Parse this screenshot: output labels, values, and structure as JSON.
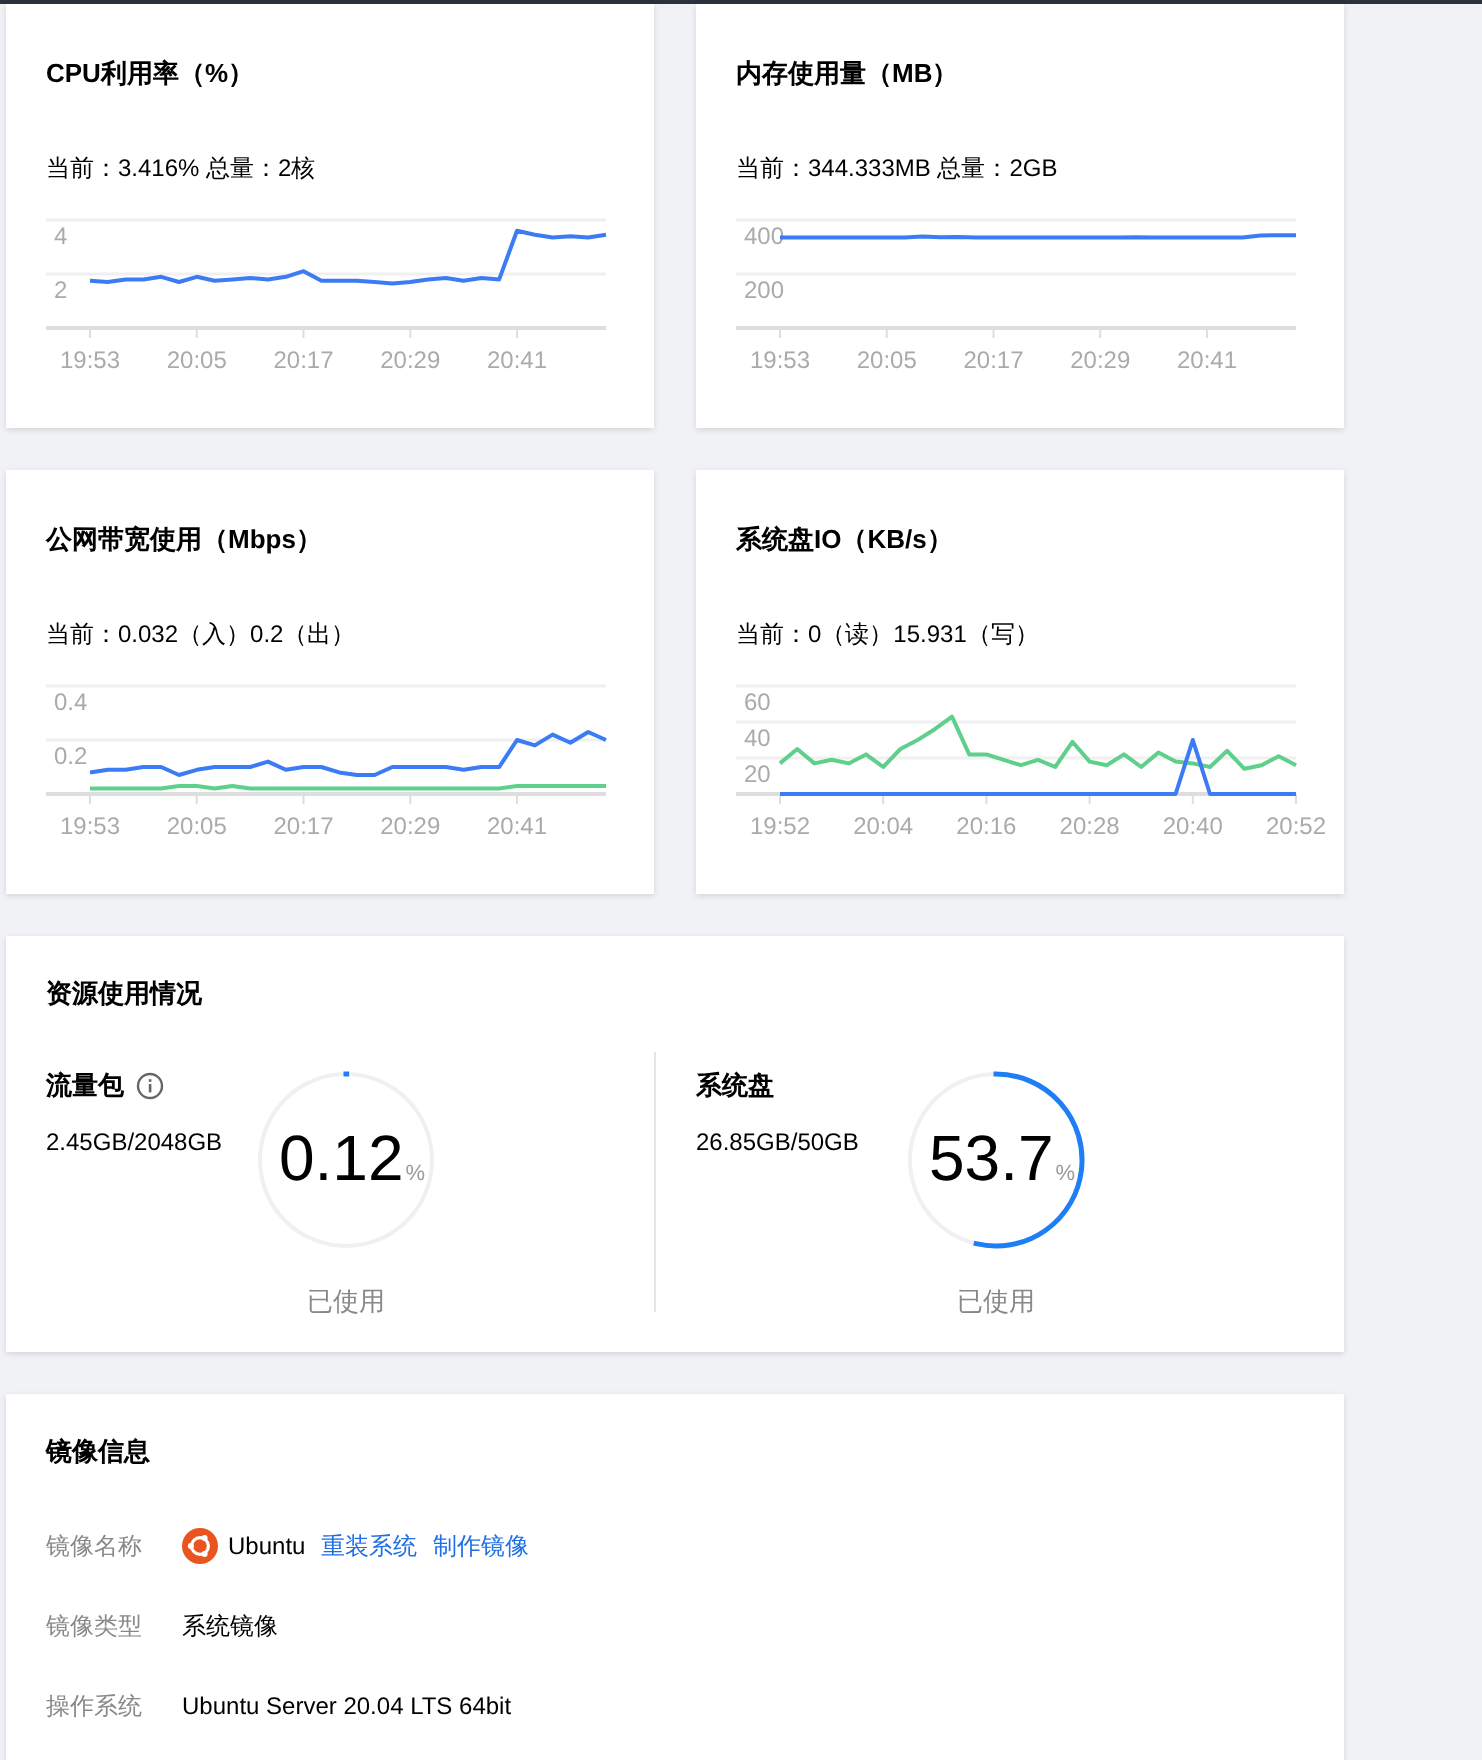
{
  "metric_cards": [
    {
      "title": "CPU利用率（%）",
      "current": "当前：3.416% 总量：2核",
      "chart_data": {
        "type": "line",
        "categories": [
          "19:53",
          null,
          null,
          null,
          null,
          null,
          "20:05",
          null,
          null,
          null,
          null,
          null,
          "20:17",
          null,
          null,
          null,
          null,
          null,
          "20:29",
          null,
          null,
          null,
          null,
          null,
          "20:41",
          null,
          null,
          null,
          null,
          null
        ],
        "ylim": [
          0,
          4
        ],
        "yticks": [
          2,
          4
        ],
        "series": [
          {
            "color": "#3b7cf5",
            "values": [
              1.75,
              1.7,
              1.8,
              1.8,
              1.9,
              1.7,
              1.9,
              1.75,
              1.8,
              1.85,
              1.8,
              1.9,
              2.1,
              1.75,
              1.75,
              1.75,
              1.7,
              1.65,
              1.7,
              1.8,
              1.85,
              1.75,
              1.85,
              1.8,
              3.6,
              3.45,
              3.35,
              3.4,
              3.35,
              3.45
            ]
          }
        ]
      }
    },
    {
      "title": "内存使用量（MB）",
      "current": "当前：344.333MB 总量：2GB",
      "chart_data": {
        "type": "line",
        "categories": [
          "19:53",
          null,
          null,
          null,
          null,
          null,
          "20:05",
          null,
          null,
          null,
          null,
          null,
          "20:17",
          null,
          null,
          null,
          null,
          null,
          "20:29",
          null,
          null,
          null,
          null,
          null,
          "20:41",
          null,
          null,
          null,
          null,
          null
        ],
        "ylim": [
          0,
          400
        ],
        "yticks": [
          200,
          400
        ],
        "series": [
          {
            "color": "#3b7cf5",
            "values": [
              335,
              335,
              335,
              335,
              335,
              335,
              335,
              335,
              339,
              336,
              337,
              335,
              335,
              335,
              335,
              335,
              335,
              335,
              335,
              335,
              336,
              335,
              335,
              335,
              335,
              335,
              335,
              343,
              344,
              344
            ]
          }
        ]
      }
    },
    {
      "title": "公网带宽使用（Mbps）",
      "current": "当前：0.032（入）0.2（出）",
      "chart_data": {
        "type": "line",
        "categories": [
          "19:53",
          null,
          null,
          null,
          null,
          null,
          "20:05",
          null,
          null,
          null,
          null,
          null,
          "20:17",
          null,
          null,
          null,
          null,
          null,
          "20:29",
          null,
          null,
          null,
          null,
          null,
          "20:41",
          null,
          null,
          null,
          null,
          null
        ],
        "ylim": [
          0,
          0.4
        ],
        "yticks": [
          0.2,
          0.4
        ],
        "series": [
          {
            "color": "#3b7cf5",
            "values": [
              0.08,
              0.09,
              0.09,
              0.1,
              0.1,
              0.07,
              0.09,
              0.1,
              0.1,
              0.1,
              0.12,
              0.09,
              0.1,
              0.1,
              0.08,
              0.07,
              0.07,
              0.1,
              0.1,
              0.1,
              0.1,
              0.09,
              0.1,
              0.1,
              0.2,
              0.18,
              0.22,
              0.19,
              0.23,
              0.2
            ]
          },
          {
            "color": "#5fcf8c",
            "values": [
              0.02,
              0.02,
              0.02,
              0.02,
              0.02,
              0.03,
              0.03,
              0.02,
              0.03,
              0.02,
              0.02,
              0.02,
              0.02,
              0.02,
              0.02,
              0.02,
              0.02,
              0.02,
              0.02,
              0.02,
              0.02,
              0.02,
              0.02,
              0.02,
              0.03,
              0.03,
              0.03,
              0.03,
              0.03,
              0.03
            ]
          }
        ]
      }
    },
    {
      "title": "系统盘IO（KB/s）",
      "current": "当前：0（读）15.931（写）",
      "chart_data": {
        "type": "line",
        "categories": [
          "19:52",
          null,
          null,
          null,
          null,
          null,
          "20:04",
          null,
          null,
          null,
          null,
          null,
          "20:16",
          null,
          null,
          null,
          null,
          null,
          "20:28",
          null,
          null,
          null,
          null,
          null,
          "20:40",
          null,
          null,
          null,
          null,
          null,
          "20:52"
        ],
        "ylim": [
          0,
          60
        ],
        "yticks": [
          20,
          40,
          60
        ],
        "series": [
          {
            "color": "#5fcf8c",
            "values": [
              17,
              25,
              17,
              19,
              17,
              22,
              15,
              25,
              30,
              36,
              43,
              22,
              22,
              19,
              16,
              19,
              15,
              29,
              18,
              16,
              22,
              15,
              23,
              18,
              17,
              15,
              24,
              14,
              16,
              21,
              16
            ]
          },
          {
            "color": "#3b7cf5",
            "values": [
              0,
              0,
              0,
              0,
              0,
              0,
              0,
              0,
              0,
              0,
              0,
              0,
              0,
              0,
              0,
              0,
              0,
              0,
              0,
              0,
              0,
              0,
              0,
              0,
              30,
              0,
              0,
              0,
              0,
              0,
              0
            ]
          }
        ]
      }
    }
  ],
  "resource_usage": {
    "title": "资源使用情况",
    "items": [
      {
        "name": "流量包",
        "has_info": true,
        "amount": "2.45GB/2048GB",
        "percent": "0.12",
        "unit": "%",
        "level": 0.0012,
        "caption": "已使用"
      },
      {
        "name": "系统盘",
        "has_info": false,
        "amount": "26.85GB/50GB",
        "percent": "53.7",
        "unit": "%",
        "level": 0.537,
        "caption": "已使用"
      }
    ]
  },
  "image_info": {
    "title": "镜像信息",
    "rows": [
      {
        "kind": "os",
        "label": "镜像名称",
        "value": "Ubuntu",
        "links": [
          "重装系统",
          "制作镜像"
        ]
      },
      {
        "kind": "text",
        "label": "镜像类型",
        "value": "系统镜像"
      },
      {
        "kind": "text",
        "label": "操作系统",
        "value": "Ubuntu Server 20.04 LTS 64bit"
      }
    ]
  }
}
